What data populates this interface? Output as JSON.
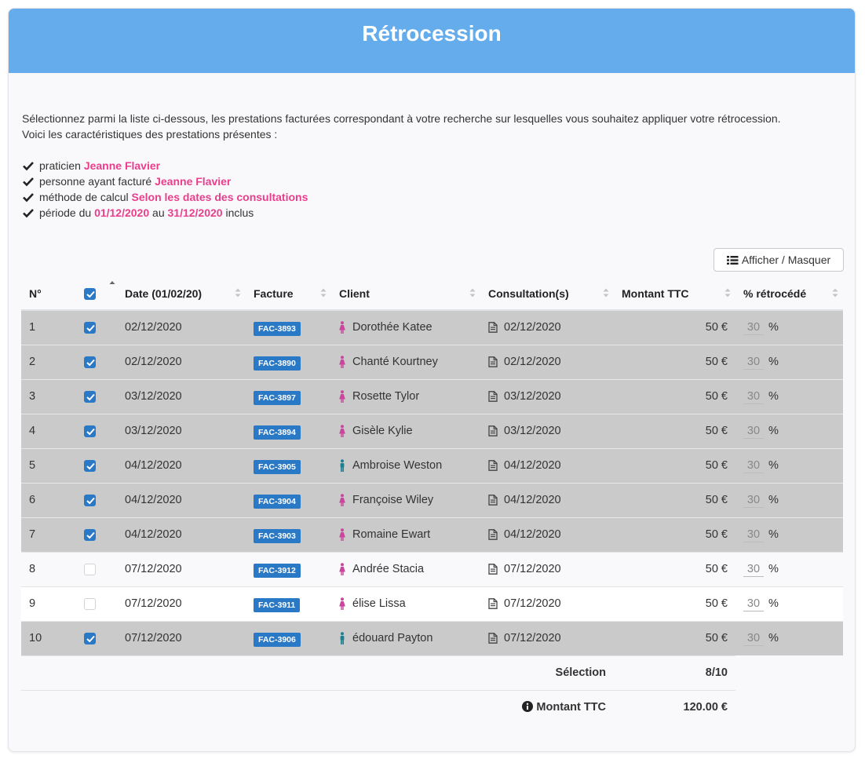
{
  "header": {
    "title": "Rétrocession"
  },
  "intro": {
    "line1": "Sélectionnez parmi la liste ci-dessous, les prestations facturées correspondant à votre recherche sur lesquelles vous souhaitez appliquer votre rétrocession.",
    "line2": "Voici les caractéristiques des prestations présentes :"
  },
  "criteria": {
    "praticien_label": "praticien",
    "praticien_value": "Jeanne Flavier",
    "facture_label": "personne ayant facturé",
    "facture_value": "Jeanne Flavier",
    "methode_label": "méthode de calcul",
    "methode_value": "Selon les dates des consultations",
    "periode_label": "période du",
    "periode_from": "01/12/2020",
    "periode_au": "au",
    "periode_to": "31/12/2020",
    "periode_suffix": "inclus"
  },
  "toolbar": {
    "toggle_columns_label": "Afficher / Masquer"
  },
  "table": {
    "columns": {
      "num": "N°",
      "date": "Date (01/02/20)",
      "facture": "Facture",
      "client": "Client",
      "consultation": "Consultation(s)",
      "montant": "Montant TTC",
      "pct": "% rétrocédé"
    },
    "rows": [
      {
        "num": "1",
        "checked": true,
        "date": "02/12/2020",
        "facture": "FAC-3893",
        "client": "Dorothée Katee",
        "gender": "female",
        "consultation": "02/12/2020",
        "montant": "50 €",
        "pct": "30",
        "pct_unit": "%"
      },
      {
        "num": "2",
        "checked": true,
        "date": "02/12/2020",
        "facture": "FAC-3890",
        "client": "Chanté Kourtney",
        "gender": "female",
        "consultation": "02/12/2020",
        "montant": "50 €",
        "pct": "30",
        "pct_unit": "%"
      },
      {
        "num": "3",
        "checked": true,
        "date": "03/12/2020",
        "facture": "FAC-3897",
        "client": "Rosette Tylor",
        "gender": "female",
        "consultation": "03/12/2020",
        "montant": "50 €",
        "pct": "30",
        "pct_unit": "%"
      },
      {
        "num": "4",
        "checked": true,
        "date": "03/12/2020",
        "facture": "FAC-3894",
        "client": "Gisèle Kylie",
        "gender": "female",
        "consultation": "03/12/2020",
        "montant": "50 €",
        "pct": "30",
        "pct_unit": "%"
      },
      {
        "num": "5",
        "checked": true,
        "date": "04/12/2020",
        "facture": "FAC-3905",
        "client": "Ambroise Weston",
        "gender": "male",
        "consultation": "04/12/2020",
        "montant": "50 €",
        "pct": "30",
        "pct_unit": "%"
      },
      {
        "num": "6",
        "checked": true,
        "date": "04/12/2020",
        "facture": "FAC-3904",
        "client": "Françoise Wiley",
        "gender": "female",
        "consultation": "04/12/2020",
        "montant": "50 €",
        "pct": "30",
        "pct_unit": "%"
      },
      {
        "num": "7",
        "checked": true,
        "date": "04/12/2020",
        "facture": "FAC-3903",
        "client": "Romaine Ewart",
        "gender": "female",
        "consultation": "04/12/2020",
        "montant": "50 €",
        "pct": "30",
        "pct_unit": "%"
      },
      {
        "num": "8",
        "checked": false,
        "date": "07/12/2020",
        "facture": "FAC-3912",
        "client": "Andrée Stacia",
        "gender": "female",
        "consultation": "07/12/2020",
        "montant": "50 €",
        "pct": "30",
        "pct_unit": "%"
      },
      {
        "num": "9",
        "checked": false,
        "date": "07/12/2020",
        "facture": "FAC-3911",
        "client": "élise Lissa",
        "gender": "female",
        "consultation": "07/12/2020",
        "montant": "50 €",
        "pct": "30",
        "pct_unit": "%"
      },
      {
        "num": "10",
        "checked": true,
        "date": "07/12/2020",
        "facture": "FAC-3906",
        "client": "édouard Payton",
        "gender": "male",
        "consultation": "07/12/2020",
        "montant": "50 €",
        "pct": "30",
        "pct_unit": "%"
      }
    ]
  },
  "summary": {
    "selection_label": "Sélection",
    "selection_value": "8/10",
    "montant_label": "Montant TTC",
    "montant_value": "120.00 €"
  },
  "colors": {
    "header_bg": "#64acec",
    "accent_blue": "#2a79c7",
    "highlight_pink": "#e83e8c",
    "female_icon": "#c8479b",
    "male_icon": "#1d7f8f",
    "selected_row_bg": "#cacaca"
  },
  "icons": {
    "check": "check-icon",
    "list": "list-icon",
    "female": "female-person-icon",
    "male": "male-person-icon",
    "document": "document-icon",
    "info": "info-circle-icon",
    "sort": "sort-icon"
  }
}
